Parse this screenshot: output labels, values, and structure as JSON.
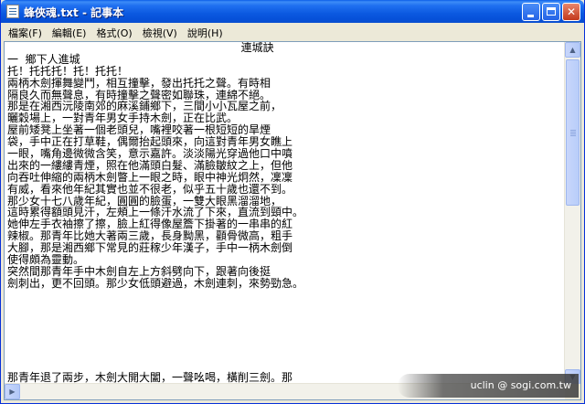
{
  "window": {
    "title": "蜂俠魂.txt - 記事本"
  },
  "menu": {
    "items": [
      "檔案(F)",
      "編輯(E)",
      "格式(O)",
      "檢視(V)",
      "說明(H)"
    ]
  },
  "document": {
    "lines": [
      "                                                                   連城訣",
      "一  鄉下人進城",
      "托！托托托！托！托托！",
      "兩柄木劍揮舞變鬥，相互撞擊，發出托托之聲。有時相",
      "隔良久而無聲息，有時撞擊之聲密如聯珠，連綿不絕。",
      "那是在湘西沅陵南郊的麻溪鋪鄉下，三間小小瓦屋之前，",
      "曬穀場上，一對青年男女手持木劍，正在比武。",
      "屋前矮凳上坐著一個老頭兒，嘴裡咬著一根短短的旱煙",
      "袋，手中正在打草鞋，偶爾抬起頭來，向這對青年男女瞧上",
      "一眼，嘴角邊微微含笑，意示嘉許。淡淡陽光穿過他口中噴",
      "出來的一縷縷青煙，照在他滿頭白髮、滿臉皺紋之上，但他",
      "向吞吐伸縮的兩柄木劍瞥上一眼之時，眼中神光炯然，凜凜",
      "有威，看來他年紀其實也並不很老，似乎五十歲也還不到。",
      "那少女十七八歲年紀，圓圓的臉蛋，一雙大眼黑溜溜地，",
      "這時累得額頭見汗，左頰上一條汗水流了下來，直流到頸中。",
      "她伸左手衣袖擦了擦，臉上紅得像屋簷下掛著的一串串的紅",
      "辣椒。那青年比她大著兩三歲，長身黝黑，顴骨微高，粗手",
      "大腳，那是湘西鄉下常見的莊稼少年漢子，手中一柄木劍倒",
      "使得頗為靈動。",
      "突然間那青年手中木劍自左上方斜劈向下，跟著向後挺",
      "劍刺出，更不回頭。那少女低頭避過，木劍連刺，來勢勁急。",
      "",
      "",
      "",
      "",
      "",
      "",
      "",
      "那青年退了兩步，木劍大開大闔，一聲吆喝，橫削三劍。那"
    ]
  },
  "watermark": {
    "text": "uclin  @ sogi.com.tw"
  }
}
